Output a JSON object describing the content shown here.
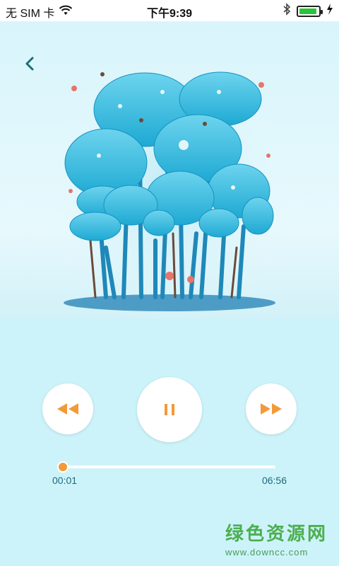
{
  "status_bar": {
    "carrier": "无 SIM 卡",
    "time": "下午9:39",
    "battery_level": 0.92,
    "battery_color": "#28c43c"
  },
  "player": {
    "back_icon": "chevron-left-icon",
    "artwork_description_icon": "tree-illustration",
    "buttons": {
      "rewind": "rewind-icon",
      "pause": "pause-icon",
      "forward": "fast-forward-icon"
    },
    "accent_color": "#f29a3a",
    "elapsed": "00:01",
    "total": "06:56",
    "progress": 0.004
  },
  "watermark": {
    "title": "绿色资源网",
    "url": "www.downcc.com"
  }
}
